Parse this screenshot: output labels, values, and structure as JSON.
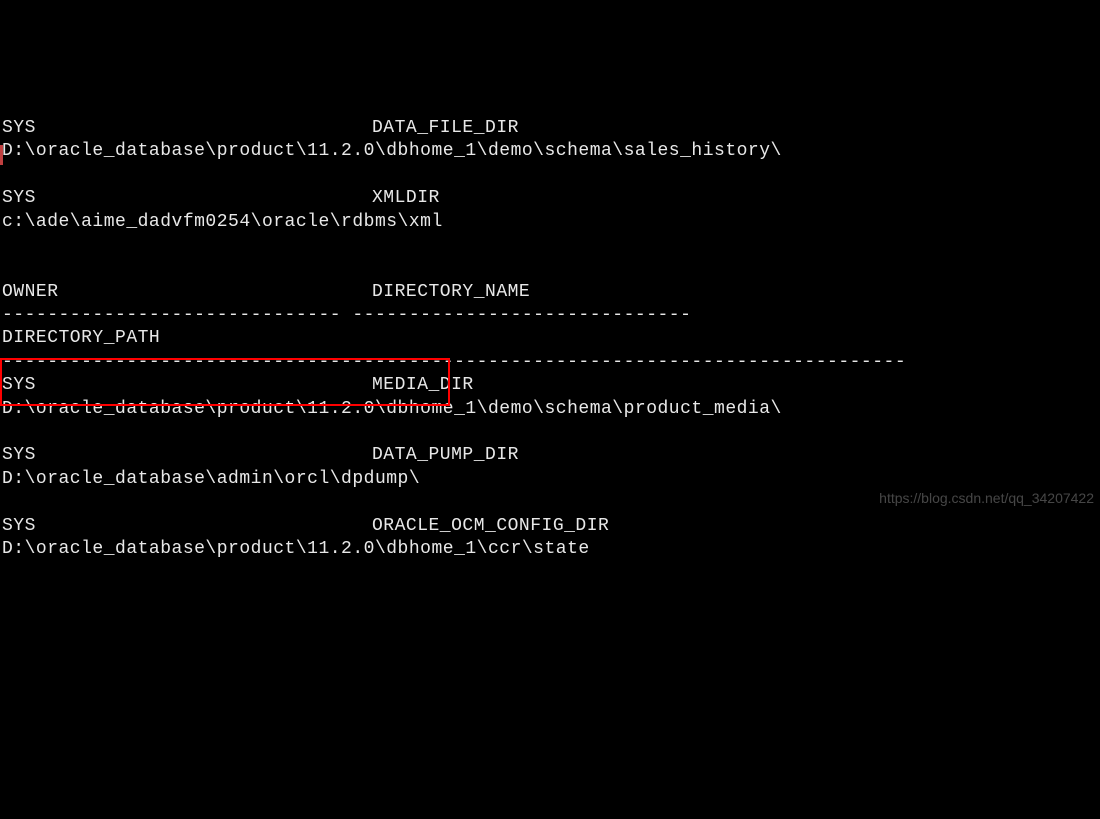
{
  "lines": {
    "l1a": "SYS",
    "l1b": "DATA_FILE_DIR",
    "l2": "D:\\oracle_database\\product\\11.2.0\\dbhome_1\\demo\\schema\\sales_history\\",
    "l3": "",
    "l4a": "SYS",
    "l4b": "XMLDIR",
    "l5": "c:\\ade\\aime_dadvfm0254\\oracle\\rdbms\\xml",
    "l6": "",
    "l7": "",
    "l8a": "OWNER",
    "l8b": "DIRECTORY_NAME",
    "l9": "------------------------------ ------------------------------",
    "l10": "DIRECTORY_PATH",
    "l11": "--------------------------------------------------------------------------------",
    "l12a": "SYS",
    "l12b": "MEDIA_DIR",
    "l13": "D:\\oracle_database\\product\\11.2.0\\dbhome_1\\demo\\schema\\product_media\\",
    "l14": "",
    "l15a": "SYS",
    "l15b": "DATA_PUMP_DIR",
    "l16": "D:\\oracle_database\\admin\\orcl\\dpdump\\",
    "l17": "",
    "l18a": "SYS",
    "l18b": "ORACLE_OCM_CONFIG_DIR",
    "l19": "D:\\oracle_database\\product\\11.2.0\\dbhome_1\\ccr\\state"
  },
  "watermark": "https://blog.csdn.net/qq_34207422"
}
